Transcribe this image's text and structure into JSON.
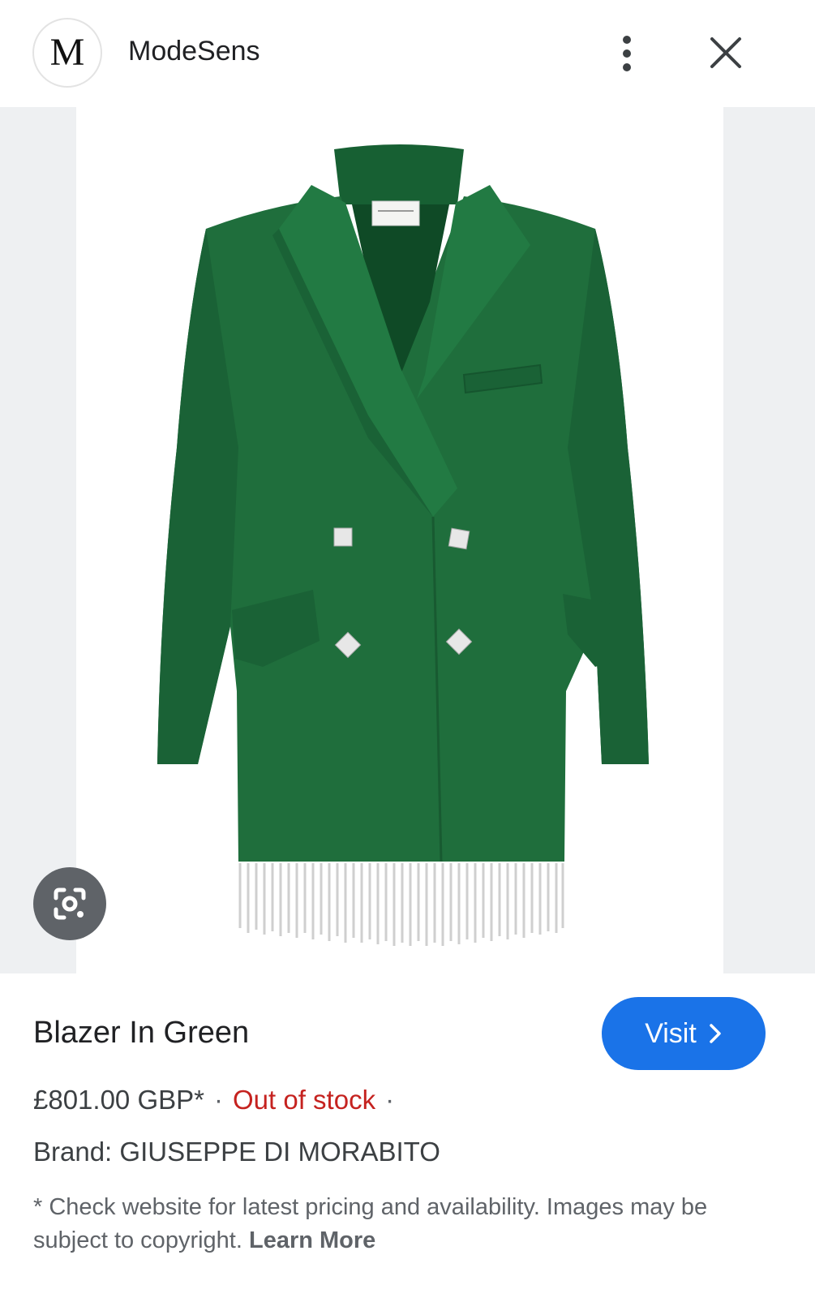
{
  "header": {
    "logo_letter": "M",
    "site_name": "ModeSens"
  },
  "product": {
    "title": "Blazer In Green",
    "visit_label": "Visit",
    "price": "£801.00 GBP*",
    "separator": "·",
    "stock_status": "Out of stock",
    "brand": "Brand: GIUSEPPE DI MORABITO",
    "disclaimer": "* Check website for latest pricing and availability. Images may be subject to copyright.",
    "learn_more": "Learn More"
  },
  "colors": {
    "accent": "#1a73e8",
    "out_of_stock": "#c5221f",
    "jacket_green": "#1f6e3c"
  },
  "icons": [
    "more-vert-icon",
    "close-icon",
    "google-lens-icon",
    "chevron-right-icon"
  ]
}
